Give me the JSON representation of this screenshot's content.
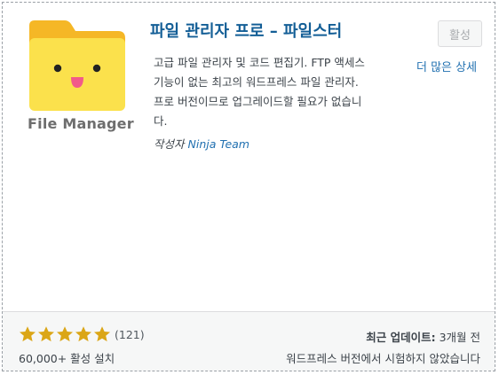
{
  "plugin": {
    "title": "파일 관리자 프로 – 파일스터",
    "logo_text": "File Manager",
    "install_label": "활성",
    "more_details_label": "더 많은 상세",
    "description": "고급 파일 관리자 및 코드 편집기. FTP 액세스 기능이 없는 최고의 워드프레스 파일 관리자. 프로 버전이므로 업그레이드할 필요가 없습니다.",
    "author_label": "작성자",
    "author_name": "Ninja Team"
  },
  "footer": {
    "rating_stars": 5,
    "rating_count": "(121)",
    "installs": "60,000+ 활성 설치",
    "updated_label": "최근 업데이트:",
    "updated_value": "3개월 전",
    "compatibility": "워드프레스 버전에서 시험하지 않았습니다"
  },
  "colors": {
    "folder": "#f9d949",
    "folder_tab": "#f5b726",
    "star": "#dba617",
    "link": "#2271b1"
  }
}
